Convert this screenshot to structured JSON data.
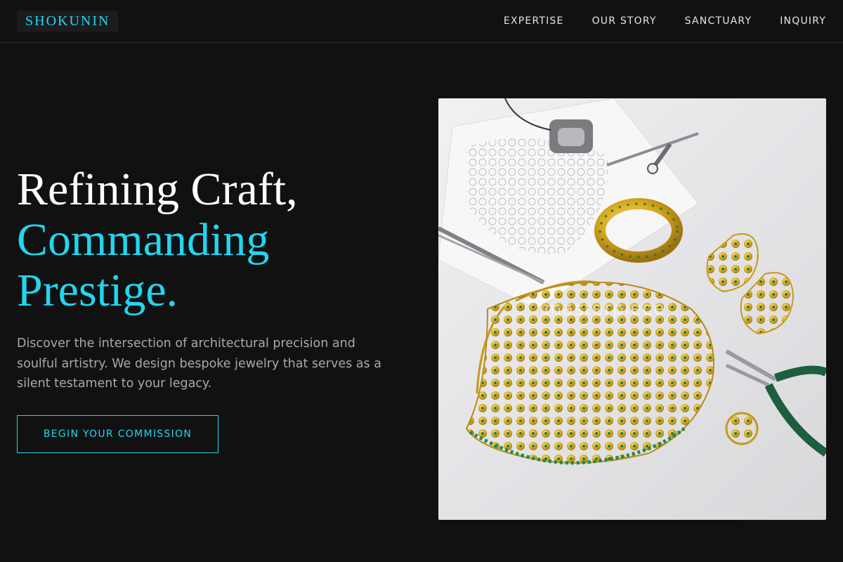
{
  "brand": {
    "logo": "SHOKUNIN"
  },
  "nav": [
    {
      "label": "EXPERTISE"
    },
    {
      "label": "OUR STORY"
    },
    {
      "label": "SANCTUARY"
    },
    {
      "label": "INQUIRY"
    }
  ],
  "hero": {
    "title_line1": "Refining Craft,",
    "title_line2": "Commanding Prestige.",
    "description": "Discover the intersection of architectural precision and soulful artistry. We design bespoke jewelry that serves as a silent testament to your legacy.",
    "cta_label": "BEGIN YOUR COMMISSION"
  },
  "image": {
    "subject": "gold jewelry set with sketch and jeweler tools",
    "watermark": "masterpiece"
  },
  "colors": {
    "background": "#111112",
    "accent": "#22d6ee",
    "text": "#ffffff",
    "muted": "#a9a9ad"
  }
}
